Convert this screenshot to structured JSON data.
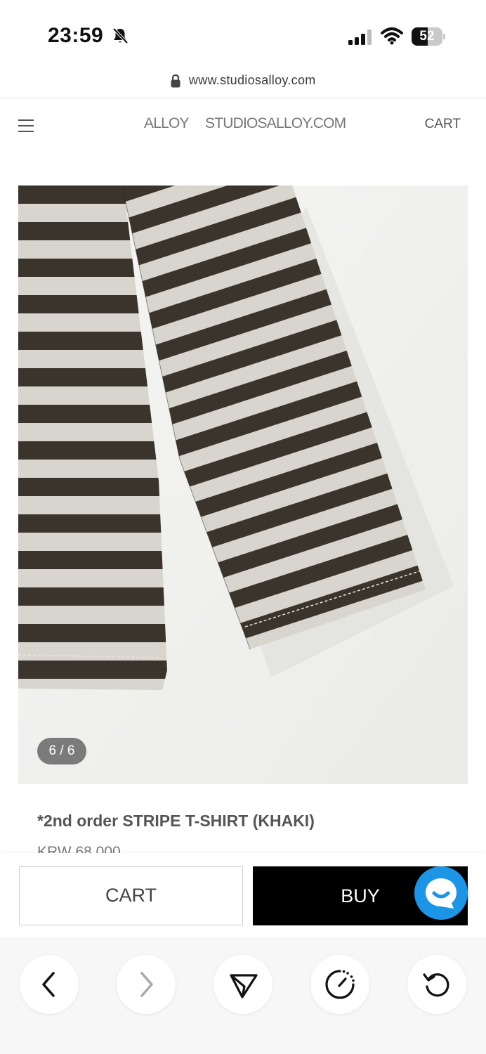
{
  "status_bar": {
    "time": "23:59",
    "battery_level": "52",
    "battery_fraction": 0.52
  },
  "browser": {
    "url": "www.studiosalloy.com"
  },
  "site_header": {
    "logo": "ALLOY",
    "site_name": "STUDIOSALLOY.COM",
    "cart_label": "CART"
  },
  "product": {
    "image_counter": "6 / 6",
    "title": "*2nd order STRIPE T-SHIRT (KHAKI)",
    "price": "KRW 68,000"
  },
  "actions": {
    "cart_label": "CART",
    "buy_label": "BUY"
  },
  "colors": {
    "stripe_dark": "#3a342c",
    "stripe_light": "#d8d4ce",
    "buy_bg": "#000000",
    "chat_bg": "#1c95e6"
  },
  "icons": {
    "menu": "hamburger-menu-icon",
    "back": "chevron-left-icon",
    "forward": "chevron-right-icon",
    "share": "send-triangle-icon",
    "speed": "speedometer-icon",
    "reload": "reload-icon",
    "chat": "chat-bubble-icon"
  }
}
